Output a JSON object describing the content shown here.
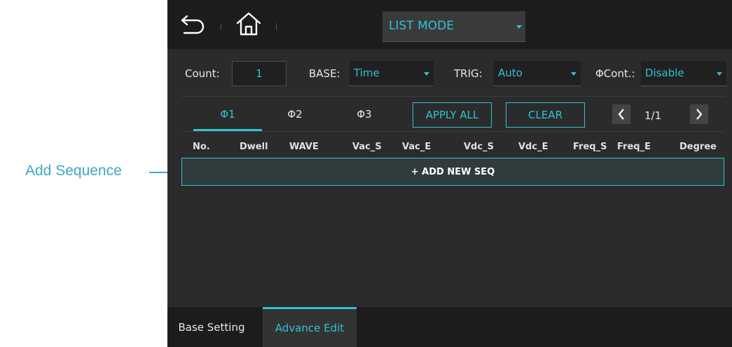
{
  "annotation": {
    "label": "Add Sequence",
    "color": "#3fa7c7"
  },
  "header": {
    "mode_value": "LIST MODE"
  },
  "settings": {
    "count_label": "Count:",
    "count_value": "1",
    "base_label": "BASE:",
    "base_value": "Time",
    "trig_label": "TRIG:",
    "trig_value": "Auto",
    "phase_cont_label": "ΦCont.:",
    "phase_cont_value": "Disable"
  },
  "phase_tabs": [
    {
      "label": "Φ1",
      "active": true
    },
    {
      "label": "Φ2",
      "active": false
    },
    {
      "label": "Φ3",
      "active": false
    }
  ],
  "actions": {
    "apply_all": "APPLY ALL",
    "clear": "CLEAR"
  },
  "pager": {
    "text": "1/1"
  },
  "table": {
    "columns": [
      "No.",
      "Dwell",
      "WAVE",
      "Vac_S",
      "Vac_E",
      "Vdc_S",
      "Vdc_E",
      "Freq_S",
      "Freq_E",
      "Degree"
    ]
  },
  "add_seq": {
    "label": "+ ADD NEW SEQ"
  },
  "bottom_tabs": [
    {
      "label": "Base Setting",
      "active": false
    },
    {
      "label": "Advance Edit",
      "active": true
    }
  ],
  "colors": {
    "accent": "#2ec3d4",
    "background": "#2b2b2b",
    "bar": "#1c1c1c"
  },
  "icons": {
    "back": "undo-arrow-icon",
    "home": "home-icon",
    "prev": "chevron-left-icon",
    "next": "chevron-right-icon",
    "dropdown": "caret-down-icon"
  }
}
